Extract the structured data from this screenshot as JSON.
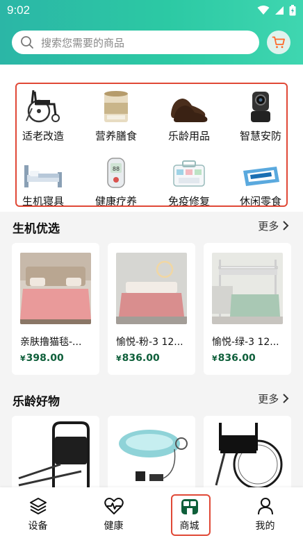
{
  "status_bar": {
    "time": "9:02"
  },
  "search": {
    "placeholder": "搜索您需要的商品"
  },
  "categories": [
    {
      "label": "适老改造",
      "icon": "wheelchair-icon"
    },
    {
      "label": "营养膳食",
      "icon": "milk-powder-can-icon"
    },
    {
      "label": "乐龄用品",
      "icon": "leather-shoes-icon"
    },
    {
      "label": "智慧安防",
      "icon": "security-camera-icon"
    },
    {
      "label": "生机寝具",
      "icon": "bed-icon"
    },
    {
      "label": "健康疗养",
      "icon": "glucose-meter-icon"
    },
    {
      "label": "免疫修复",
      "icon": "first-aid-kit-icon"
    },
    {
      "label": "休闲零食",
      "icon": "snack-biscuit-icon"
    }
  ],
  "section1": {
    "title": "生机优选",
    "more": "更多",
    "products": [
      {
        "name": "亲肤撸猫毯-...",
        "price": "398.00",
        "currency": "¥"
      },
      {
        "name": "愉悦-粉-3 12...",
        "price": "836.00",
        "currency": "¥"
      },
      {
        "name": "愉悦-绿-3 12...",
        "price": "836.00",
        "currency": "¥"
      }
    ]
  },
  "section2": {
    "title": "乐龄好物",
    "more": "更多"
  },
  "tabs": [
    {
      "label": "设备",
      "icon": "layers-icon"
    },
    {
      "label": "健康",
      "icon": "heart-pulse-icon"
    },
    {
      "label": "商城",
      "icon": "store-icon",
      "active": true
    },
    {
      "label": "我的",
      "icon": "person-icon"
    }
  ],
  "colors": {
    "accent": "#2cc9a4",
    "price": "#0e5f3a",
    "highlight": "#e04836"
  }
}
